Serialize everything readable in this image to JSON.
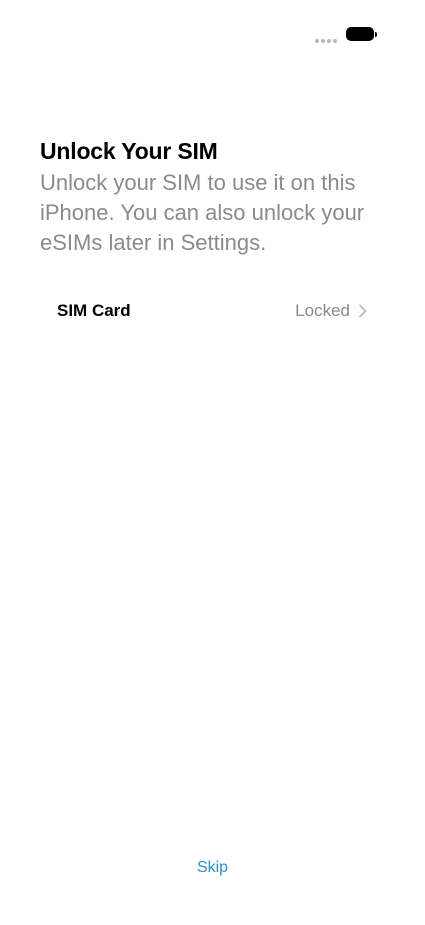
{
  "status_bar": {
    "signal_icon": "signal-dots-icon",
    "battery_icon": "battery-icon"
  },
  "header": {
    "title": "Unlock Your SIM",
    "subtitle": "Unlock your SIM to use it on this iPhone. You can also unlock your eSIMs later in Settings."
  },
  "sim_row": {
    "label": "SIM Card",
    "status": "Locked",
    "chevron_icon": "chevron-right-icon"
  },
  "footer": {
    "skip_label": "Skip"
  },
  "colors": {
    "background": "#ffffff",
    "title_text": "#000000",
    "secondary_text": "#8a8a8e",
    "accent": "#2a8fc4"
  }
}
